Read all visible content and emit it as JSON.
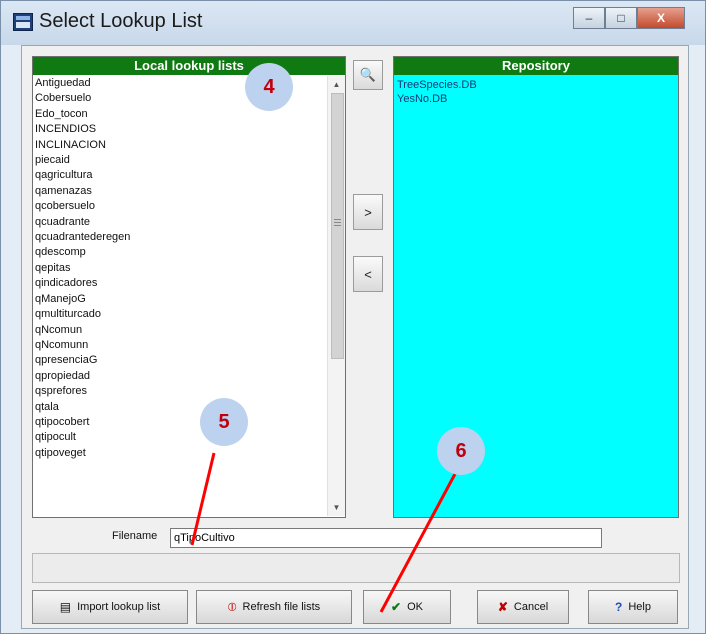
{
  "window": {
    "title": "Select Lookup List"
  },
  "window_controls": {
    "minimize": "–",
    "maximize": "□",
    "close": "X"
  },
  "left_panel": {
    "title": "Local lookup lists",
    "items": [
      "Antiguedad",
      "Cobersuelo",
      "Edo_tocon",
      "INCENDIOS",
      "INCLINACION",
      "piecaid",
      "qagricultura",
      "qamenazas",
      "qcobersuelo",
      "qcuadrante",
      "qcuadrantederegen",
      "qdescomp",
      "qepitas",
      "qindicadores",
      "qManejoG",
      "qmultiturcado",
      "qNcomun",
      "qNcomunn",
      "qpresenciaG",
      "qpropiedad",
      "qsprefores",
      "qtala",
      "qtipocobert",
      "qtipocult",
      "qtipoveget"
    ]
  },
  "right_panel": {
    "title": "Repository",
    "items": [
      "TreeSpecies.DB",
      "YesNo.DB"
    ]
  },
  "middle_buttons": {
    "zoom": "🔍",
    "add": ">",
    "remove": "<"
  },
  "filename": {
    "label": "Filename",
    "value": "qTipoCultivo"
  },
  "buttons": {
    "import": "Import lookup list",
    "refresh": "Refresh file lists",
    "ok": "OK",
    "cancel": "Cancel",
    "help": "Help"
  },
  "annotations": [
    "4",
    "5",
    "6"
  ],
  "colors": {
    "panel_header": "#0f7a12",
    "repository_bg": "#00ffff",
    "annotation_text": "#c0000f",
    "annotation_bg": "#bdd2ee"
  }
}
